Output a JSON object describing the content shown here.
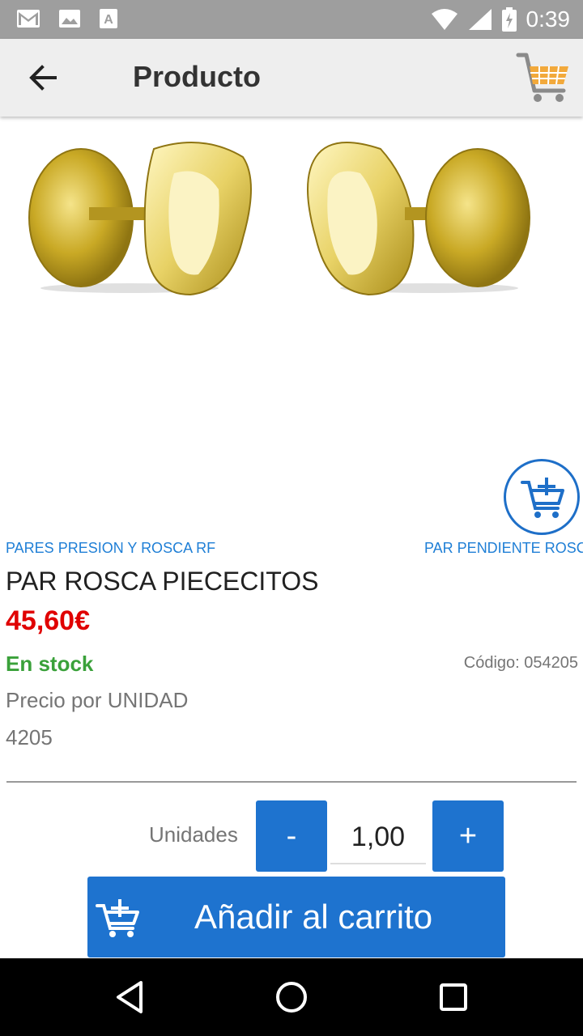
{
  "status_bar": {
    "time": "0:39",
    "icons": [
      "gmail-icon",
      "image-icon",
      "font-icon",
      "wifi-icon",
      "signal-icon",
      "battery-icon"
    ]
  },
  "app_bar": {
    "title": "Producto",
    "back_icon": "arrow-left-icon",
    "cart_icon": "shopping-cart-icon"
  },
  "product": {
    "family": "PARES PRESION Y ROSCA RF",
    "subfamily": "PAR PENDIENTE ROSC",
    "name": "PAR ROSCA PIECECITOS",
    "price": "45,60€",
    "stock": "En stock",
    "code": "Código: 054205",
    "unit_price": "Precio por UNIDAD",
    "reference": "4205"
  },
  "quantity": {
    "label": "Unidades",
    "minus_label": "-",
    "plus_label": "+",
    "value": "1,00"
  },
  "add_to_cart": {
    "label": "Añadir al carrito",
    "icon": "cart-plus-icon"
  },
  "colors": {
    "accent": "#1e73cf",
    "price": "#e00000",
    "stock": "#3aa13a",
    "link": "#1f7fd6"
  }
}
